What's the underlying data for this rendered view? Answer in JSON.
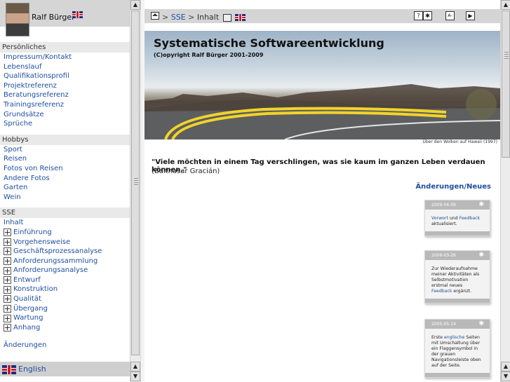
{
  "left": {
    "owner_name": "Ralf Bürger",
    "sections": [
      {
        "title": "Persönliches",
        "items": [
          "Impressum/Kontakt",
          "Lebenslauf",
          "Qualifikationsprofil",
          "Projektreferenz",
          "Beratungsreferenz",
          "Trainingsreferenz",
          "Grundsätze",
          "Sprüche"
        ]
      },
      {
        "title": "Hobbys",
        "items": [
          "Sport",
          "Reisen",
          "Fotos von Reisen",
          "Andere Fotos",
          "Garten",
          "Wein"
        ]
      }
    ],
    "sse": {
      "title": "SSE",
      "first": "Inhalt",
      "expandable": [
        "Einführung",
        "Vorgehensweise",
        "Geschäftsprozessanalyse",
        "Anforderungssammlung",
        "Anforderungsanalyse",
        "Entwurf",
        "Konstruktion",
        "Qualität",
        "Übergang",
        "Wartung",
        "Anhang"
      ]
    },
    "changes_link": "Änderungen",
    "language_label": "English"
  },
  "breadcrumb": {
    "home": "home-icon",
    "sep": ">",
    "sse": "SSE",
    "current": "Inhalt"
  },
  "toolbar": {
    "help": "?",
    "star": "✱",
    "search": "A-",
    "next": "▶"
  },
  "banner": {
    "title": "Systematische Softwareentwicklung",
    "copyright": "(C)opyright Ralf Bürger 2001-2009",
    "caption": "Über den Wolken auf Hawaii (1997)"
  },
  "quote": {
    "text": "\"Viele möchten in einem Tag verschlingen, was sie kaum im ganzen Leben verdauen können.\"",
    "author": "(Balthasar Gracián)"
  },
  "changes": {
    "heading": "Änderungen/Neues",
    "notes": [
      {
        "date": "2009-04-09",
        "parts": [
          {
            "t": "Vorwort",
            "link": true
          },
          {
            "t": " und ",
            "link": false
          },
          {
            "t": "Feedback",
            "link": true
          },
          {
            "t": " aktualisiert.",
            "link": false
          }
        ]
      },
      {
        "date": "2006-03-26",
        "parts": [
          {
            "t": "Zur Wiederaufnahme meiner Aktivitäten als Selbstmotivation erstmal neues ",
            "link": false
          },
          {
            "t": "Feedback",
            "link": true
          },
          {
            "t": " ergänzt.",
            "link": false
          }
        ]
      },
      {
        "date": "2005-05-14",
        "parts": [
          {
            "t": "Erste ",
            "link": false
          },
          {
            "t": "englische",
            "link": true
          },
          {
            "t": " Seiten mit Umschaltung über ein Flaggensymbol in der grauen Navigationsleiste oben auf der Seite.",
            "link": false
          }
        ]
      }
    ]
  }
}
